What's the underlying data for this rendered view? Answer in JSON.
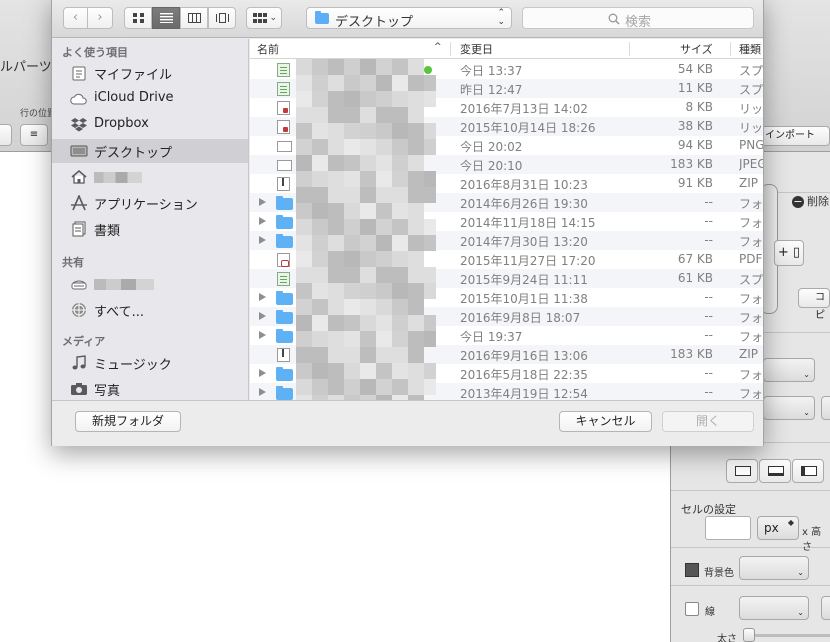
{
  "background_app": {
    "title_fragment": "ルパーツ",
    "row_position_label": "行の位置",
    "import_label": "インポート",
    "delete_label": "削除",
    "add_label": "+ ▯",
    "koho_label": "コピ",
    "cell_settings_label": "セルの設定",
    "unit_value": "px",
    "height_label": "x 高さ",
    "bg_color_label": "背景色",
    "line_label": "線",
    "thickness_label": "太さ"
  },
  "toolbar": {
    "back_icon": "chevron-left-icon",
    "forward_icon": "chevron-right-icon",
    "location_label": "デスクトップ",
    "search_placeholder": "検索"
  },
  "sidebar": {
    "favorites_heading": "よく使う項目",
    "shared_heading": "共有",
    "media_heading": "メディア",
    "items": [
      {
        "label": "マイファイル",
        "icon": "all-files-icon"
      },
      {
        "label": "iCloud Drive",
        "icon": "cloud-icon"
      },
      {
        "label": "Dropbox",
        "icon": "dropbox-icon"
      },
      {
        "label": "デスクトップ",
        "icon": "desktop-icon",
        "selected": true
      },
      {
        "label": "",
        "icon": "home-icon"
      },
      {
        "label": "アプリケーション",
        "icon": "applications-icon"
      },
      {
        "label": "書類",
        "icon": "documents-icon"
      }
    ],
    "shared_items": [
      {
        "label": "",
        "icon": "server-icon"
      },
      {
        "label": "すべて...",
        "icon": "network-icon"
      }
    ],
    "media_items": [
      {
        "label": "ミュージック",
        "icon": "music-icon"
      },
      {
        "label": "写真",
        "icon": "camera-icon"
      }
    ]
  },
  "file_list": {
    "columns": {
      "name": "名前",
      "modified": "変更日",
      "size": "サイズ",
      "kind": "種類"
    },
    "rows": [
      {
        "type": "sheet",
        "date": "今日 13:37",
        "size": "54 KB",
        "kind": "スプ",
        "tag": "green"
      },
      {
        "type": "sheet",
        "date": "昨日 12:47",
        "size": "11 KB",
        "kind": "スプ"
      },
      {
        "type": "red",
        "date": "2016年7月13日 14:02",
        "size": "8 KB",
        "kind": "リッ"
      },
      {
        "type": "red",
        "date": "2015年10月14日 18:26",
        "size": "38 KB",
        "kind": "リッ"
      },
      {
        "type": "img",
        "date": "今日 20:02",
        "size": "94 KB",
        "kind": "PNG"
      },
      {
        "type": "img",
        "date": "今日 20:10",
        "size": "183 KB",
        "kind": "JPEG"
      },
      {
        "type": "zip",
        "date": "2016年8月31日 10:23",
        "size": "91 KB",
        "kind": "ZIP"
      },
      {
        "type": "folder",
        "date": "2014年6月26日 19:30",
        "size": "--",
        "kind": "フォ"
      },
      {
        "type": "folder",
        "date": "2014年11月18日 14:15",
        "size": "--",
        "kind": "フォ"
      },
      {
        "type": "folder",
        "date": "2014年7月30日 13:20",
        "size": "--",
        "kind": "フォ"
      },
      {
        "type": "pdf",
        "date": "2015年11月27日 17:20",
        "size": "67 KB",
        "kind": "PDF"
      },
      {
        "type": "sheet",
        "date": "2015年9月24日 11:11",
        "size": "61 KB",
        "kind": "スプ"
      },
      {
        "type": "folder",
        "date": "2015年10月1日 11:38",
        "size": "--",
        "kind": "フォ"
      },
      {
        "type": "folder",
        "date": "2016年9月8日 18:07",
        "size": "--",
        "kind": "フォ"
      },
      {
        "type": "folder",
        "date": "今日 19:37",
        "size": "--",
        "kind": "フォ"
      },
      {
        "type": "zip",
        "date": "2016年9月16日 13:06",
        "size": "183 KB",
        "kind": "ZIP"
      },
      {
        "type": "folder",
        "date": "2016年5月18日 22:35",
        "size": "--",
        "kind": "フォ"
      },
      {
        "type": "folder",
        "date": "2013年4月19日 12:54",
        "size": "--",
        "kind": "フォ"
      }
    ]
  },
  "footer": {
    "new_folder_label": "新規フォルダ",
    "cancel_label": "キャンセル",
    "open_label": "開く"
  },
  "colors": {
    "accent_folder": "#5fb1f5",
    "tag_green": "#58c43f",
    "selection": "#d0d0d4"
  }
}
